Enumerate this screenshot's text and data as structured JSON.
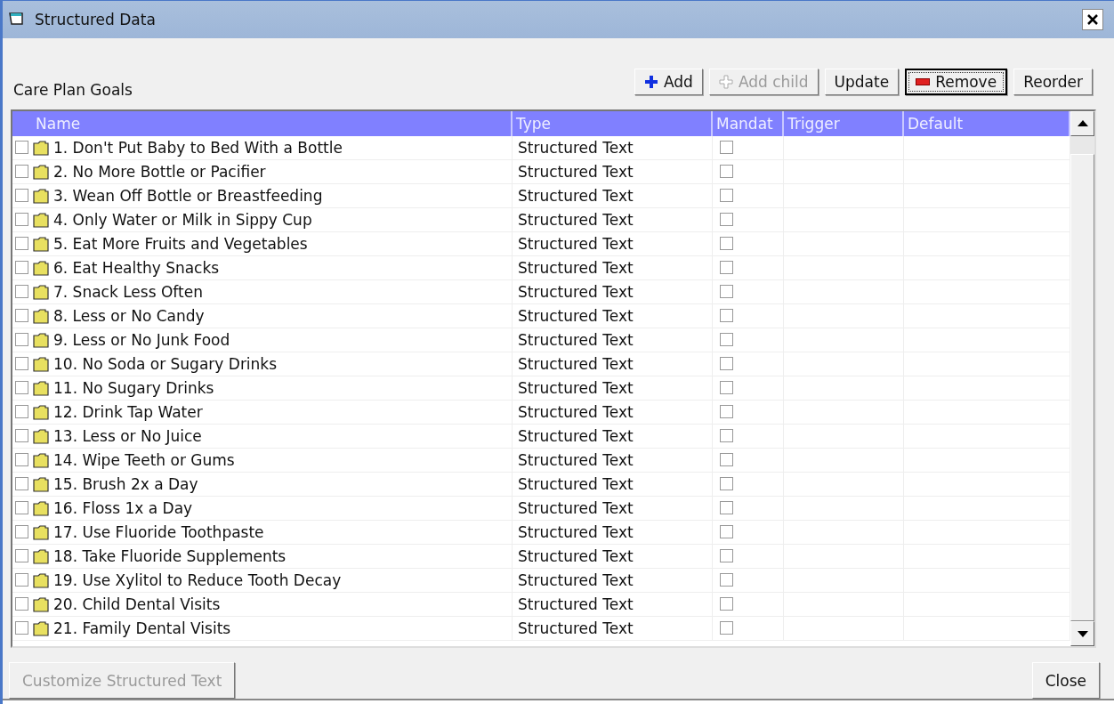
{
  "window": {
    "title": "Structured Data"
  },
  "section_label": "Care Plan Goals",
  "toolbar": [
    {
      "label": "Add",
      "kind": "add",
      "disabled": false,
      "focused": false
    },
    {
      "label": "Add child",
      "kind": "add",
      "disabled": true,
      "focused": false
    },
    {
      "label": "Update",
      "kind": "plain",
      "disabled": false,
      "focused": false
    },
    {
      "label": "Remove",
      "kind": "remove",
      "disabled": false,
      "focused": true
    },
    {
      "label": "Reorder",
      "kind": "plain",
      "disabled": false,
      "focused": false
    }
  ],
  "table": {
    "columns": [
      "Name",
      "Type",
      "Mandat",
      "Trigger",
      "Default"
    ],
    "rows": [
      {
        "name": "1. Don't Put Baby to Bed With a Bottle",
        "type": "Structured Text",
        "checked": false,
        "mandatory": false
      },
      {
        "name": "2. No More Bottle or Pacifier",
        "type": "Structured Text",
        "checked": false,
        "mandatory": false
      },
      {
        "name": "3. Wean Off Bottle or Breastfeeding",
        "type": "Structured Text",
        "checked": false,
        "mandatory": false
      },
      {
        "name": "4. Only Water or Milk in Sippy Cup",
        "type": "Structured Text",
        "checked": false,
        "mandatory": false
      },
      {
        "name": "5. Eat More Fruits and Vegetables",
        "type": "Structured Text",
        "checked": false,
        "mandatory": false
      },
      {
        "name": "6. Eat Healthy Snacks",
        "type": "Structured Text",
        "checked": false,
        "mandatory": false
      },
      {
        "name": "7. Snack Less Often",
        "type": "Structured Text",
        "checked": false,
        "mandatory": false
      },
      {
        "name": "8. Less or No Candy",
        "type": "Structured Text",
        "checked": false,
        "mandatory": false
      },
      {
        "name": "9. Less or No Junk Food",
        "type": "Structured Text",
        "checked": false,
        "mandatory": false
      },
      {
        "name": "10. No Soda or Sugary Drinks",
        "type": "Structured Text",
        "checked": false,
        "mandatory": false
      },
      {
        "name": "11. No Sugary Drinks",
        "type": "Structured Text",
        "checked": false,
        "mandatory": false
      },
      {
        "name": "12. Drink Tap Water",
        "type": "Structured Text",
        "checked": false,
        "mandatory": false
      },
      {
        "name": "13. Less or No Juice",
        "type": "Structured Text",
        "checked": false,
        "mandatory": false
      },
      {
        "name": "14. Wipe Teeth or Gums",
        "type": "Structured Text",
        "checked": false,
        "mandatory": false
      },
      {
        "name": "15. Brush 2x a Day",
        "type": "Structured Text",
        "checked": false,
        "mandatory": false
      },
      {
        "name": "16. Floss 1x a Day",
        "type": "Structured Text",
        "checked": false,
        "mandatory": false
      },
      {
        "name": "17. Use Fluoride Toothpaste",
        "type": "Structured Text",
        "checked": false,
        "mandatory": false
      },
      {
        "name": "18. Take Fluoride Supplements",
        "type": "Structured Text",
        "checked": false,
        "mandatory": false
      },
      {
        "name": "19. Use Xylitol to Reduce Tooth Decay",
        "type": "Structured Text",
        "checked": false,
        "mandatory": false
      },
      {
        "name": "20. Child Dental Visits",
        "type": "Structured Text",
        "checked": false,
        "mandatory": false
      },
      {
        "name": "21. Family Dental Visits",
        "type": "Structured Text",
        "checked": false,
        "mandatory": false
      }
    ]
  },
  "footer": [
    {
      "label": "Customize Structured Text",
      "disabled": true
    },
    {
      "label": "Close",
      "disabled": false
    }
  ]
}
